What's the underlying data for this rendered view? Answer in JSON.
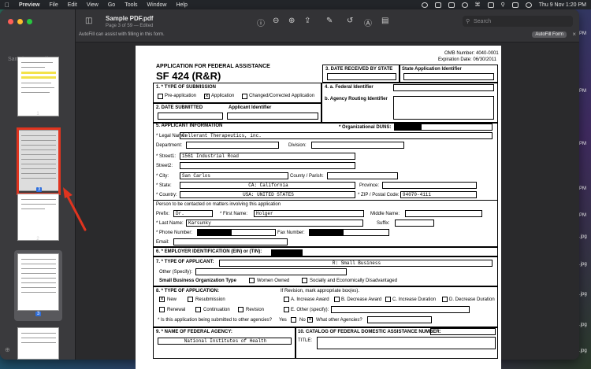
{
  "menubar": {
    "app": "Preview",
    "menus": [
      "File",
      "Edit",
      "View",
      "Go",
      "Tools",
      "Window",
      "Help"
    ],
    "clock": "Thu 9 Nov  1:20 PM"
  },
  "desktop_labels": [
    "PM",
    "PM",
    "PM",
    "PM",
    "PM",
    ".jpg",
    ".jpg",
    ".jpg",
    ".jpg",
    ".jpg"
  ],
  "toolbar": {
    "doc_title": "Sample PDF.pdf",
    "doc_subtitle": "Page 3 of 59 — Edited",
    "search_placeholder": "Search",
    "autofill_msg": "AutoFill can assist with filling in this form.",
    "autofill_btn": "AutoFill Form"
  },
  "sidebar": {
    "title": "Sample PDF.pdf",
    "thumbs": [
      {
        "num": "1"
      },
      {
        "num": "2",
        "badge": "3"
      },
      {
        "num": "3"
      }
    ]
  },
  "form": {
    "omb": "OMB Number: 4040-0001",
    "expiration": "Expiration Date: 06/30/2011",
    "title1": "APPLICATION FOR FEDERAL ASSISTANCE",
    "title2": "SF 424 (R&R)",
    "s3": "3. DATE RECEIVED BY STATE",
    "state_app_id": "State Application Identifier",
    "s1": "1. * TYPE OF SUBMISSION",
    "pre_app": "Pre-application",
    "application": "Application",
    "changed": "Changed/Corrected Application",
    "s4a": "4. a. Federal Identifier",
    "s4b": "b. Agency Routing Identifier",
    "s2": "2. DATE SUBMITTED",
    "applicant_id": "Applicant Identifier",
    "s5": "5. APPLICANT INFORMATION",
    "duns": "* Organizational DUNS:",
    "legal_name_label": "* Legal Name:",
    "legal_name": "Cellerant Therapeutics, inc.",
    "department": "Department:",
    "division": "Division:",
    "street1_label": "* Street1:",
    "street1": "1561 Industrial Road",
    "street2": "Street2:",
    "city_label": "* City:",
    "city": "San Carlos",
    "county": "County / Parish:",
    "state_label": "* State:",
    "state": "CA: California",
    "province": "Province:",
    "country_label": "* Country:",
    "country": "USA: UNITED STATES",
    "zip_label": "* ZIP / Postal Code:",
    "zip": "94070-4111",
    "contact": "Person to be contacted on matters involving this application",
    "prefix_label": "Prefix:",
    "prefix": "Dr.",
    "first_label": "* First Name:",
    "first": "Holger",
    "middle": "Middle Name:",
    "last_label": "* Last Name:",
    "last": "Karsunky",
    "suffix": "Suffix:",
    "phone": "* Phone Number:",
    "fax": "Fax Number:",
    "email": "Email:",
    "s6": "6. * EMPLOYER IDENTIFICATION (EIN) or (TIN):",
    "s7": "7. * TYPE OF APPLICANT:",
    "applicant_type": "R: Small Business",
    "other_specify": "Other (Specify):",
    "sbo_type": "Small Business Organization Type",
    "women_owned": "Women Owned",
    "socially": "Socially and Economically Disadvantaged",
    "s8": "8. * TYPE OF APPLICATION:",
    "if_revision": "If Revision, mark appropriate box(es).",
    "new": "New",
    "resubmission": "Resubmission",
    "renewal": "Renewal",
    "continuation": "Continuation",
    "revision": "Revision",
    "rev_a": "A. Increase Award",
    "rev_b": "B. Decrease Award",
    "rev_c": "C. Increase Duration",
    "rev_d": "D. Decrease Duration",
    "rev_e": "E. Other (specify):",
    "other_agencies_q": "* Is this application being submitted to other agencies?",
    "yes": "Yes",
    "no": "No",
    "what_agencies": "What other Agencies?",
    "s9": "9. * NAME OF FEDERAL AGENCY:",
    "agency": "National Institutes of Health",
    "s10": "10. CATALOG OF FEDERAL DOMESTIC ASSISTANCE NUMBER:",
    "title_label": "TITLE:"
  }
}
